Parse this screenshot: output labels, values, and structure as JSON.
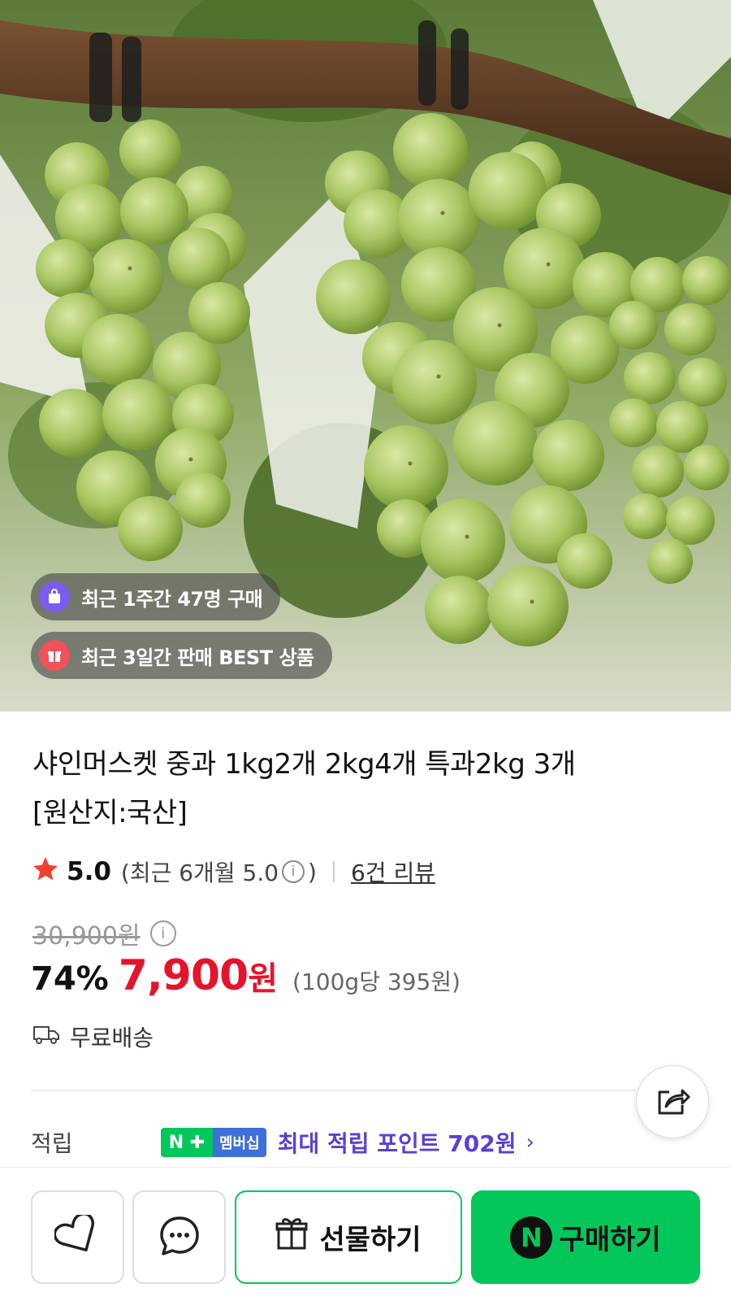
{
  "hero": {
    "badges": [
      {
        "label": "최근 1주간 47명 구매",
        "icon": "shopping-bag-icon",
        "icon_color": "#7b5cf0"
      },
      {
        "label": "최근 3일간 판매 BEST 상품",
        "icon": "gift-box-icon",
        "icon_color": "#f0525a"
      }
    ]
  },
  "product": {
    "title_line1": "샤인머스켓 중과 1kg2개 2kg4개 특과2kg 3개",
    "title_line2": "[원산지:국산]",
    "rating": {
      "score": "5.0",
      "recent_prefix": "(최근 6개월 5.0",
      "recent_suffix": ")",
      "info_icon": "i",
      "review_link": "6건 리뷰"
    },
    "price": {
      "original": "30,900원",
      "discount": "74%",
      "sale": "7,900",
      "currency": "원",
      "unit_price": "(100g당 395원)",
      "accent_color": "#e6132b"
    },
    "shipping": "무료배송"
  },
  "points": {
    "label": "적립",
    "badge_n": "N ✚",
    "badge_membership": "멤버십",
    "text": "최대 적립 포인트 702원",
    "chevron": "›",
    "color": "#5b3fd6"
  },
  "bottom_bar": {
    "gift_label": "선물하기",
    "buy_logo": "N",
    "buy_label": "구매하기",
    "brand_color": "#03c75a"
  }
}
